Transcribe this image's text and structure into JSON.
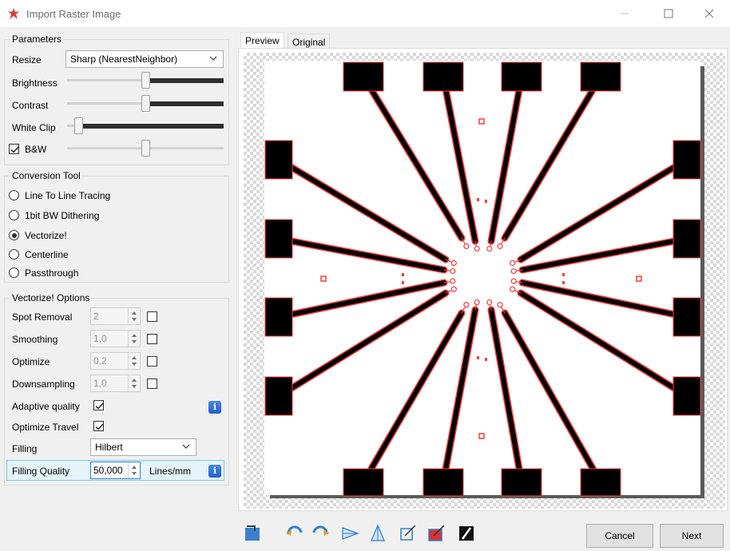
{
  "window": {
    "title": "Import Raster Image",
    "minimize_icon": "minimize-icon",
    "maximize_icon": "maximize-icon",
    "close_icon": "close-icon"
  },
  "parameters": {
    "title": "Parameters",
    "resize_label": "Resize",
    "resize_value": "Sharp (NearestNeighbor)",
    "brightness_label": "Brightness",
    "brightness_level": 0.5,
    "contrast_label": "Contrast",
    "contrast_level": 0.5,
    "whiteclip_label": "White Clip",
    "whiteclip_level": 0.05,
    "bw_label": "B&W",
    "bw_checked": true,
    "bw_level": 0.5
  },
  "conversion": {
    "title": "Conversion Tool",
    "options": [
      "Line To Line Tracing",
      "1bit BW Dithering",
      "Vectorize!",
      "Centerline",
      "Passthrough"
    ],
    "selected": "Vectorize!"
  },
  "vectorize": {
    "title": "Vectorize! Options",
    "spot_removal_label": "Spot Removal",
    "spot_removal_value": "2",
    "smoothing_label": "Smoothing",
    "smoothing_value": "1,0",
    "optimize_label": "Optimize",
    "optimize_value": "0,2",
    "downsampling_label": "Downsampling",
    "downsampling_value": "1,0",
    "adaptive_label": "Adaptive quality",
    "adaptive_checked": true,
    "travel_label": "Optimize Travel",
    "travel_checked": true,
    "filling_label": "Filling",
    "filling_value": "Hilbert",
    "filling_quality_label": "Filling Quality",
    "filling_quality_value": "50,000",
    "filling_quality_unit": "Lines/mm",
    "info_glyph": "i"
  },
  "tabs": [
    "Preview",
    "Original"
  ],
  "active_tab": "Preview",
  "toolbar_icons": [
    "rotate-back-icon",
    "rotate-left-icon",
    "rotate-right-icon",
    "flip-horizontal-icon",
    "flip-vertical-icon",
    "crop-icon",
    "auto-crop-icon",
    "invert-icon"
  ],
  "buttons": {
    "cancel": "Cancel",
    "next": "Next"
  },
  "colors": {
    "trace": "#ff3b3b",
    "fill": "#000000",
    "accent": "#2f80d0"
  }
}
